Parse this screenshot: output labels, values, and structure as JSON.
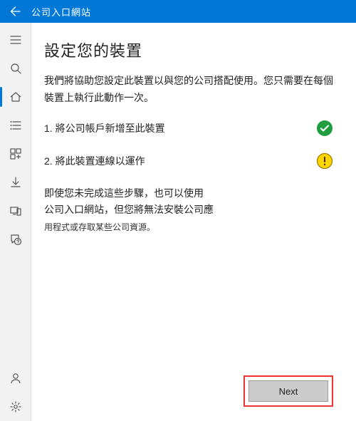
{
  "titlebar": {
    "back_icon": "back-arrow-icon",
    "title": "公司入口網站"
  },
  "sidebar": {
    "items": [
      {
        "id": "menu",
        "icon": "hamburger-icon"
      },
      {
        "id": "search",
        "icon": "search-icon"
      },
      {
        "id": "home",
        "icon": "home-icon",
        "active": true
      },
      {
        "id": "list",
        "icon": "list-icon"
      },
      {
        "id": "apps",
        "icon": "apps-icon"
      },
      {
        "id": "download",
        "icon": "download-icon"
      },
      {
        "id": "devices",
        "icon": "devices-icon"
      },
      {
        "id": "support",
        "icon": "support-icon"
      }
    ],
    "bottom": [
      {
        "id": "account",
        "icon": "account-icon"
      },
      {
        "id": "settings",
        "icon": "settings-icon"
      }
    ]
  },
  "page": {
    "title": "設定您的裝置",
    "intro": "我們將協助您設定此裝置以與您的公司搭配使用。您只需要在每個裝置上執行此動作一次。",
    "steps": [
      {
        "label": "1. 將公司帳戶新增至此裝置",
        "status": "done"
      },
      {
        "label": "2. 將此裝置連線以運作",
        "status": "warn"
      }
    ],
    "note_line1": "即使您未完成這些步驟，也可以使用",
    "note_line2": "公司入口網站，但您將無法安裝公司應",
    "note_line3": "用程式或存取某些公司資源。"
  },
  "footer": {
    "next_label": "Next"
  },
  "colors": {
    "accent": "#0078d7",
    "success": "#1e9e3e",
    "warn_fill": "#ffd400",
    "warn_stroke": "#9a7a00"
  }
}
